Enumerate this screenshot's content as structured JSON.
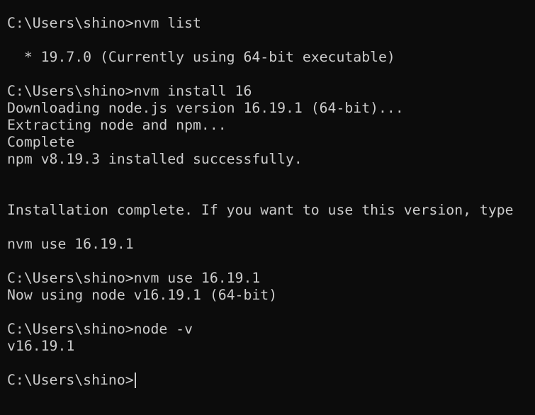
{
  "terminal": {
    "lines": [
      "C:\\Users\\shino>nvm list",
      "",
      "  * 19.7.0 (Currently using 64-bit executable)",
      "",
      "C:\\Users\\shino>nvm install 16",
      "Downloading node.js version 16.19.1 (64-bit)...",
      "Extracting node and npm...",
      "Complete",
      "npm v8.19.3 installed successfully.",
      "",
      "",
      "Installation complete. If you want to use this version, type",
      "",
      "nvm use 16.19.1",
      "",
      "C:\\Users\\shino>nvm use 16.19.1",
      "Now using node v16.19.1 (64-bit)",
      "",
      "C:\\Users\\shino>node -v",
      "v16.19.1",
      "",
      "C:\\Users\\shino>"
    ]
  }
}
